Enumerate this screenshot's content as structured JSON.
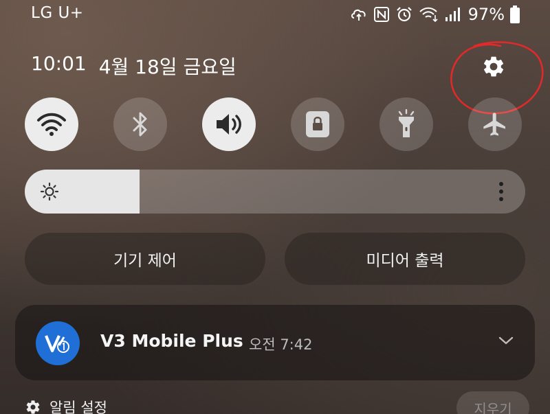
{
  "status_bar": {
    "carrier": "LG U+",
    "battery": "97%",
    "icons": [
      "cloud-sync-icon",
      "nfc-icon",
      "alarm-icon",
      "wifi-data-icon",
      "signal-icon",
      "battery-icon"
    ]
  },
  "header": {
    "time": "10:01",
    "date": "4월 18일 금요일",
    "settings_icon": "gear-icon",
    "annotation_color": "#e02a2a"
  },
  "quick_settings": [
    {
      "name": "wifi",
      "icon": "wifi-icon",
      "state": "on"
    },
    {
      "name": "bluetooth",
      "icon": "bluetooth-icon",
      "state": "off"
    },
    {
      "name": "sound",
      "icon": "speaker-icon",
      "state": "on"
    },
    {
      "name": "screen-lock",
      "icon": "lock-icon",
      "state": "off"
    },
    {
      "name": "flashlight",
      "icon": "flashlight-icon",
      "state": "off"
    },
    {
      "name": "airplane-mode",
      "icon": "airplane-icon",
      "state": "off"
    }
  ],
  "brightness": {
    "level": 0.23,
    "icon": "sun-icon",
    "more_icon": "more-vertical-icon"
  },
  "controls": {
    "device_control": "기기 제어",
    "media_output": "미디어 출력"
  },
  "notification": {
    "app_name": "V3 Mobile Plus",
    "time": "오전 7:42",
    "app_icon_color": "#1f6fd6",
    "expand_icon": "chevron-down-icon"
  },
  "footer": {
    "notification_settings": "알림 설정",
    "clear": "지우기"
  }
}
